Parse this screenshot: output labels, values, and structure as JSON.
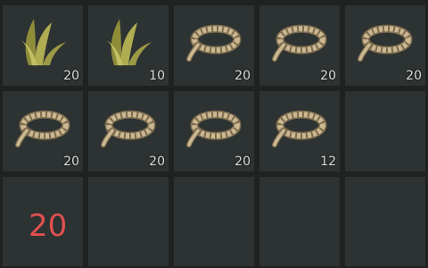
{
  "inventory": {
    "rows": [
      [
        {
          "item": "grass-fiber-icon",
          "count": "20"
        },
        {
          "item": "grass-fiber-icon",
          "count": "10"
        },
        {
          "item": "rope-icon",
          "count": "20"
        },
        {
          "item": "rope-icon",
          "count": "20"
        },
        {
          "item": "rope-icon",
          "count": "20"
        }
      ],
      [
        {
          "item": "rope-icon",
          "count": "20"
        },
        {
          "item": "rope-icon",
          "count": "20"
        },
        {
          "item": "rope-icon",
          "count": "20"
        },
        {
          "item": "rope-icon",
          "count": "12"
        },
        {
          "item": null,
          "count": ""
        }
      ],
      [
        {
          "item": null,
          "count": ""
        },
        {
          "item": null,
          "count": ""
        },
        {
          "item": null,
          "count": ""
        },
        {
          "item": null,
          "count": ""
        },
        {
          "item": null,
          "count": ""
        }
      ]
    ]
  },
  "overlay": {
    "count_label": "20",
    "count_color": "#e0504f"
  },
  "colors": {
    "slot": "#2d3232",
    "background": "#202222",
    "rope": "#cbb892",
    "grass": "#a9a647"
  }
}
